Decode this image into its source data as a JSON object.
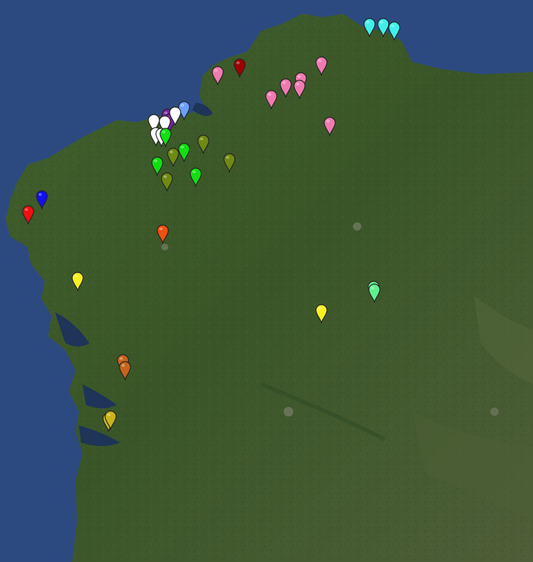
{
  "colors": {
    "sea": "#2f4f86",
    "land": "#3d5a2c",
    "land_dark": "#2f4a22",
    "land_light": "#5a6e3e",
    "urban": "#8a8a7a"
  },
  "pin_icon": "map-marker-icon",
  "markers": [
    {
      "group": "cyan",
      "color": "#40f0e8",
      "lon": 0.693,
      "lat": 0.05
    },
    {
      "group": "cyan",
      "color": "#40f0e8",
      "lon": 0.719,
      "lat": 0.05
    },
    {
      "group": "cyan",
      "color": "#40f0e8",
      "lon": 0.74,
      "lat": 0.056
    },
    {
      "group": "dark-red",
      "color": "#a00000",
      "lon": 0.45,
      "lat": 0.122
    },
    {
      "group": "pink",
      "color": "#f07ab0",
      "lon": 0.409,
      "lat": 0.135
    },
    {
      "group": "pink",
      "color": "#f07ab0",
      "lon": 0.603,
      "lat": 0.118
    },
    {
      "group": "pink",
      "color": "#f07ab0",
      "lon": 0.565,
      "lat": 0.147
    },
    {
      "group": "pink",
      "color": "#f07ab0",
      "lon": 0.536,
      "lat": 0.158
    },
    {
      "group": "pink",
      "color": "#f07ab0",
      "lon": 0.562,
      "lat": 0.16
    },
    {
      "group": "pink",
      "color": "#f07ab0",
      "lon": 0.509,
      "lat": 0.178
    },
    {
      "group": "pink",
      "color": "#f07ab0",
      "lon": 0.618,
      "lat": 0.226
    },
    {
      "group": "purple",
      "color": "#7a1fa0",
      "lon": 0.314,
      "lat": 0.211
    },
    {
      "group": "purple",
      "color": "#7a1fa0",
      "lon": 0.318,
      "lat": 0.22
    },
    {
      "group": "light-blue",
      "color": "#6aa0ff",
      "lon": 0.345,
      "lat": 0.198
    },
    {
      "group": "white",
      "color": "#ffffff",
      "lon": 0.289,
      "lat": 0.221
    },
    {
      "group": "white",
      "color": "#ffffff",
      "lon": 0.329,
      "lat": 0.207
    },
    {
      "group": "white",
      "color": "#ffffff",
      "lon": 0.309,
      "lat": 0.224
    },
    {
      "group": "white",
      "color": "#ffffff",
      "lon": 0.293,
      "lat": 0.244
    },
    {
      "group": "white",
      "color": "#ffffff",
      "lon": 0.303,
      "lat": 0.245
    },
    {
      "group": "green",
      "color": "#10e010",
      "lon": 0.31,
      "lat": 0.245
    },
    {
      "group": "green",
      "color": "#10e010",
      "lon": 0.345,
      "lat": 0.272
    },
    {
      "group": "green",
      "color": "#10e010",
      "lon": 0.295,
      "lat": 0.297
    },
    {
      "group": "green",
      "color": "#10e010",
      "lon": 0.367,
      "lat": 0.316
    },
    {
      "group": "olive",
      "color": "#6e8a10",
      "lon": 0.382,
      "lat": 0.258
    },
    {
      "group": "olive",
      "color": "#6e8a10",
      "lon": 0.325,
      "lat": 0.281
    },
    {
      "group": "olive",
      "color": "#6e8a10",
      "lon": 0.43,
      "lat": 0.29
    },
    {
      "group": "olive",
      "color": "#6e8a10",
      "lon": 0.313,
      "lat": 0.325
    },
    {
      "group": "blue",
      "color": "#1010f0",
      "lon": 0.079,
      "lat": 0.357
    },
    {
      "group": "red",
      "color": "#f01010",
      "lon": 0.053,
      "lat": 0.384
    },
    {
      "group": "orange-red",
      "color": "#f05010",
      "lon": 0.305,
      "lat": 0.417
    },
    {
      "group": "yellow",
      "color": "#f8f020",
      "lon": 0.146,
      "lat": 0.502
    },
    {
      "group": "yellow",
      "color": "#f8f020",
      "lon": 0.603,
      "lat": 0.559
    },
    {
      "group": "mint",
      "color": "#60f090",
      "lon": 0.701,
      "lat": 0.518
    },
    {
      "group": "mint",
      "color": "#60f090",
      "lon": 0.702,
      "lat": 0.523
    },
    {
      "group": "brown",
      "color": "#c8641a",
      "lon": 0.231,
      "lat": 0.648
    },
    {
      "group": "brown",
      "color": "#c8641a",
      "lon": 0.234,
      "lat": 0.66
    },
    {
      "group": "mustard",
      "color": "#c8b41a",
      "lon": 0.203,
      "lat": 0.752
    },
    {
      "group": "mustard",
      "color": "#c8b41a",
      "lon": 0.207,
      "lat": 0.748
    }
  ]
}
